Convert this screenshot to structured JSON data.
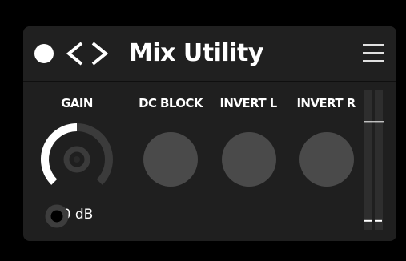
{
  "app": {
    "title": "Mix Utility"
  },
  "header": {
    "power_icon": "power-dot-icon",
    "prev_icon": "chevron-left-icon",
    "next_icon": "chevron-right-icon",
    "menu_icon": "hamburger-menu-icon"
  },
  "controls": {
    "gain": {
      "label": "GAIN",
      "value": "0 dB",
      "level": 0.5
    },
    "dc_block": {
      "label": "DC BLOCK"
    },
    "invert_l": {
      "label": "INVERT L"
    },
    "invert_r": {
      "label": "INVERT R"
    }
  },
  "meter": {
    "peak_level": 0.78,
    "floor_level": 0.07
  },
  "colors": {
    "background": "#000000",
    "panel": "#1f1f1f",
    "toggle": "#4a4a4a",
    "knob_track": "#3b3b3b",
    "foreground": "#ffffff"
  }
}
